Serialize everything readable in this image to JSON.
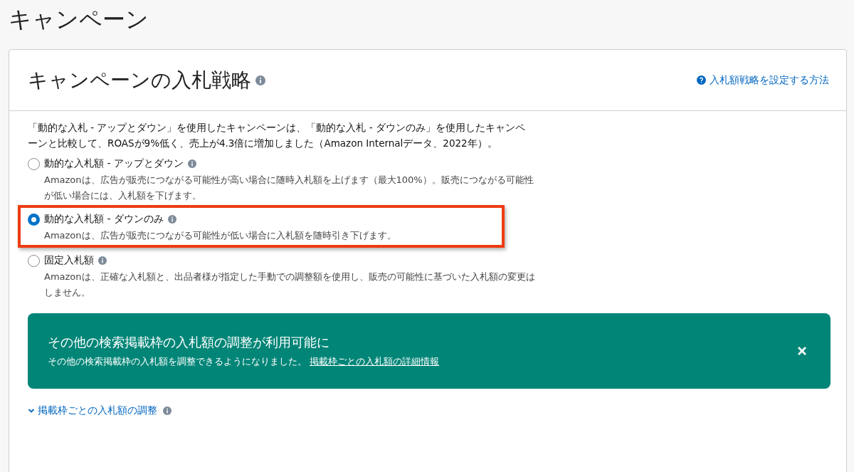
{
  "page_title": "キャンペーン",
  "card": {
    "title": "キャンペーンの入札戦略",
    "help_link": "入札額戦略を設定する方法",
    "intro": "「動的な入札 - アップとダウン」を使用したキャンペーンは、「動的な入札 - ダウンのみ」を使用したキャンペーンと比較して、ROASが9%低く、売上が4.3倍に増加しました（Amazon Internalデータ、2022年）。",
    "options": [
      {
        "label": "動的な入札額 - アップとダウン",
        "description": "Amazonは、広告が販売につながる可能性が高い場合に随時入札額を上げます（最大100%）。販売につながる可能性が低い場合には、入札額を下げます。",
        "selected": false,
        "highlighted": false
      },
      {
        "label": "動的な入札額 - ダウンのみ",
        "description": "Amazonは、広告が販売につながる可能性が低い場合に入札額を随時引き下げます。",
        "selected": true,
        "highlighted": true
      },
      {
        "label": "固定入札額",
        "description": "Amazonは、正確な入札額と、出品者様が指定した手動での調整額を使用し、販売の可能性に基づいた入札額の変更はしません。",
        "selected": false,
        "highlighted": false
      }
    ],
    "banner": {
      "title": "その他の検索掲載枠の入札額の調整が利用可能に",
      "text": "その他の検索掲載枠の入札額を調整できるようになりました。",
      "link": "掲載枠ごとの入札額の詳細情報"
    },
    "expander": {
      "label": "掲載枠ごとの入札額の調整",
      "expanded": false
    }
  }
}
